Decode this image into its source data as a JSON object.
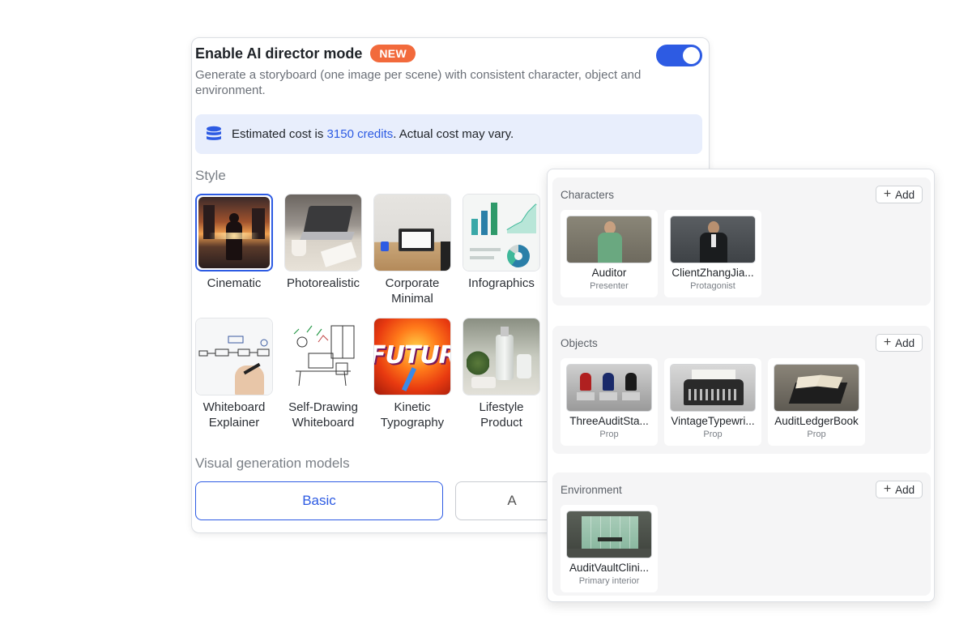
{
  "director": {
    "title": "Enable AI director mode",
    "badge": "NEW",
    "toggle_on": true,
    "description": "Generate a storyboard (one image per scene) with consistent character, object and environment."
  },
  "cost": {
    "prefix": "Estimated cost is ",
    "credits": "3150 credits",
    "suffix": ". Actual cost may vary."
  },
  "style": {
    "label": "Style",
    "items": [
      {
        "label": "Cinematic",
        "selected": true
      },
      {
        "label": "Photorealistic",
        "selected": false
      },
      {
        "label": "Corporate Minimal",
        "selected": false
      },
      {
        "label": "Infographics",
        "selected": false
      },
      {
        "label": "Whiteboard Explainer",
        "selected": false
      },
      {
        "label": "Self-Drawing Whiteboard",
        "selected": false
      },
      {
        "label": "Kinetic Typography",
        "selected": false
      },
      {
        "label": "Lifestyle Product",
        "selected": false
      }
    ],
    "kinetic_text": "FUTURE"
  },
  "models": {
    "label": "Visual generation models",
    "options": [
      {
        "label": "Basic",
        "active": true
      },
      {
        "label": "A",
        "active": false
      }
    ]
  },
  "assets": {
    "add_label": "Add",
    "characters": {
      "title": "Characters",
      "items": [
        {
          "name": "Auditor",
          "role": "Presenter"
        },
        {
          "name": "ClientZhangJia...",
          "role": "Protagonist"
        }
      ]
    },
    "objects": {
      "title": "Objects",
      "items": [
        {
          "name": "ThreeAuditSta...",
          "role": "Prop"
        },
        {
          "name": "VintageTypewri...",
          "role": "Prop"
        },
        {
          "name": "AuditLedgerBook",
          "role": "Prop"
        }
      ]
    },
    "environment": {
      "title": "Environment",
      "items": [
        {
          "name": "AuditVaultClini...",
          "role": "Primary interior"
        }
      ]
    }
  },
  "colors": {
    "accent": "#2d5be3",
    "badge": "#f26a3c",
    "cost_bg": "#e8eefc"
  }
}
